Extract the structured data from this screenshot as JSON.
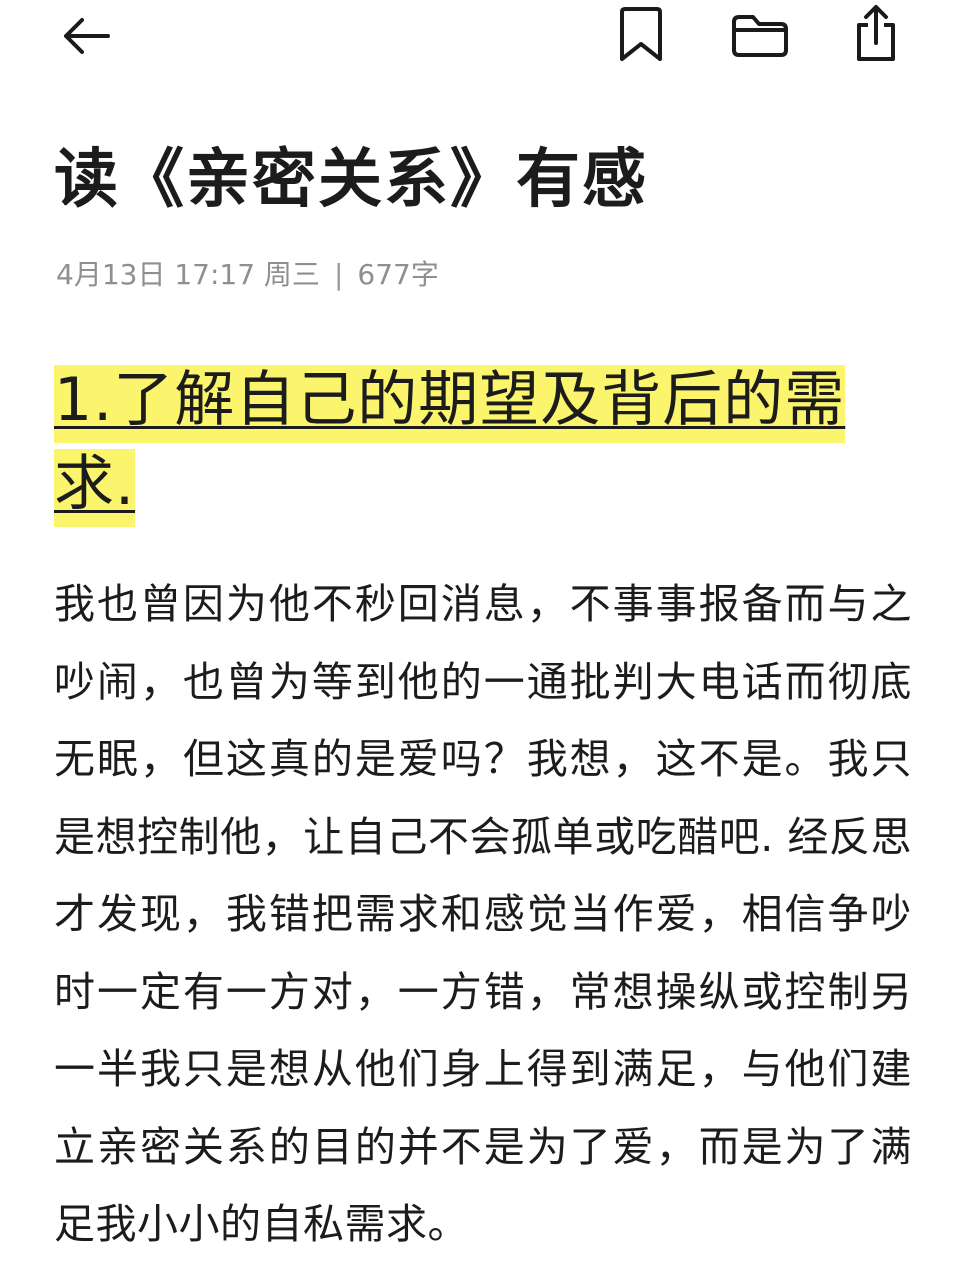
{
  "toolbar": {
    "back": {
      "icon": "arrow-left-icon"
    },
    "bookmark": {
      "icon": "bookmark-icon"
    },
    "folder": {
      "icon": "folder-icon"
    },
    "share": {
      "icon": "share-icon"
    }
  },
  "note": {
    "title": "读《亲密关系》有感",
    "date": "4月13日 17:17 周三",
    "separator": "|",
    "word_count": "677字",
    "heading": "1.了解自己的期望及背后的需求.",
    "body": "我也曾因为他不秒回消息，不事事报备而与之吵闹，也曾为等到他的一通批判大电话而彻底无眠，但这真的是爱吗？我想，这不是。我只是想控制他，让自己不会孤单或吃醋吧. 经反思才发现，我错把需求和感觉当作爱，相信争吵时一定有一方对，一方错，常想操纵或控制另一半我只是想从他们身上得到满足，与他们建立亲密关系的目的并不是为了爱，而是为了满足我小小的自私需求。"
  },
  "colors": {
    "highlight": "#fbf56d",
    "text": "#1c1c1c",
    "meta": "#8f8f8f"
  }
}
